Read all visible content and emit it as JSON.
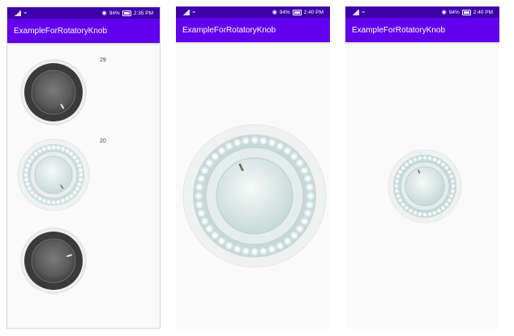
{
  "app": {
    "title": "ExampleForRotatoryKnob"
  },
  "screens": [
    {
      "status": {
        "battery": "94%",
        "time": "2:35 PM"
      },
      "values": [
        "29",
        "20"
      ],
      "knobs": [
        {
          "style": "dark",
          "angle": 148
        },
        {
          "style": "light",
          "angle": 145
        },
        {
          "style": "dark",
          "angle": 72
        }
      ]
    },
    {
      "status": {
        "battery": "94%",
        "time": "2:40 PM"
      },
      "knobs": [
        {
          "style": "light",
          "angle": -25
        }
      ]
    },
    {
      "status": {
        "battery": "94%",
        "time": "2:40 PM"
      },
      "knobs": [
        {
          "style": "light",
          "angle": -22
        }
      ]
    }
  ],
  "colors": {
    "status_bar": "#3d00a8",
    "app_bar": "#6200ee",
    "dark_knob": "#555555",
    "light_knob": "#d9e8e5",
    "dot_glow": "#e8ffff"
  },
  "icons": [
    "signal-icon",
    "usb-icon",
    "eye-icon",
    "battery-icon"
  ]
}
